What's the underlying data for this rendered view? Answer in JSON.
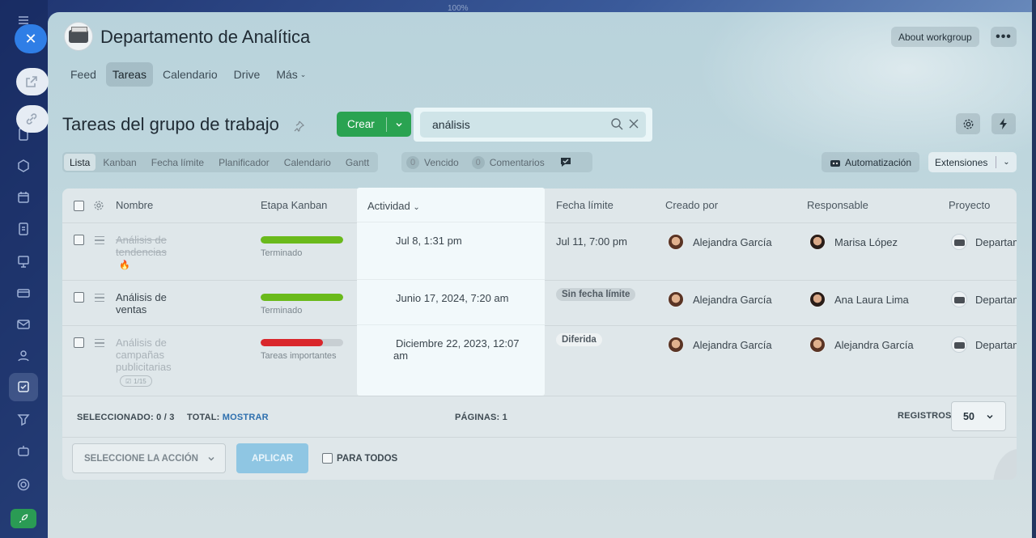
{
  "zoom": "100%",
  "group": {
    "title": "Departamento de Analítica",
    "about_label": "About workgroup"
  },
  "tabs": [
    {
      "label": "Feed",
      "active": false
    },
    {
      "label": "Tareas",
      "active": true
    },
    {
      "label": "Calendario",
      "active": false
    },
    {
      "label": "Drive",
      "active": false
    },
    {
      "label": "Más",
      "active": false
    }
  ],
  "page_title": "Tareas del grupo de trabajo",
  "toolbar": {
    "create_label": "Crear",
    "search_value": "análisis"
  },
  "views": [
    "Lista",
    "Kanban",
    "Fecha límite",
    "Planificador",
    "Calendario",
    "Gantt"
  ],
  "filters": {
    "overdue_count": "0",
    "overdue_label": "Vencido",
    "comments_count": "0",
    "comments_label": "Comentarios"
  },
  "automation_label": "Automatización",
  "extensions_label": "Extensiones",
  "columns": {
    "name": "Nombre",
    "stage": "Etapa Kanban",
    "activity": "Actividad",
    "deadline": "Fecha límite",
    "created_by": "Creado por",
    "responsible": "Responsable",
    "project": "Proyecto"
  },
  "rows": [
    {
      "name_line1": "Análisis de",
      "name_line2": "tendencias",
      "name_line3": "",
      "completed": true,
      "stage": "Terminado",
      "progress": 1.0,
      "bar_color": "#6aba1b",
      "activity": "Jul 8, 1:31 pm",
      "activity_line2": "",
      "deadline": "Jul 11, 7:00 pm",
      "created_by": "Alejandra García",
      "responsible": "Marisa López",
      "project": "Departamento de Analítica"
    },
    {
      "name_line1": "Análisis de",
      "name_line2": "ventas",
      "name_line3": "",
      "completed": false,
      "stage": "Terminado",
      "progress": 1.0,
      "bar_color": "#6aba1b",
      "activity": "Junio 17, 2024, 7:20 am",
      "activity_line2": "",
      "deadline": "Sin fecha límite",
      "created_by": "Alejandra García",
      "responsible": "Ana Laura Lima",
      "project": "Departamento de Analítica"
    },
    {
      "name_line1": "Análisis de",
      "name_line2": "campañas",
      "name_line3": "publicitarias",
      "completed": false,
      "stage": "Tareas importantes",
      "progress": 0.75,
      "bar_color": "#d9262b",
      "checklist": "1/15",
      "activity": "Diciembre 22, 2023, 12:07",
      "activity_line2": "am",
      "deadline": "Diferida",
      "created_by": "Alejandra García",
      "responsible": "Alejandra García",
      "project": "Departamento de Analítica"
    }
  ],
  "footer": {
    "selected_label": "SELECCIONADO:",
    "selected_value": "0 / 3",
    "total_label": "TOTAL:",
    "total_link": "MOSTRAR",
    "pages_label": "PÁGINAS:",
    "pages_value": "1",
    "records_label": "REGISTROS:",
    "records_value": "50"
  },
  "actions": {
    "select_placeholder": "SELECCIONE LA ACCIÓN",
    "apply_label": "APLICAR",
    "for_all_label": "PARA TODOS"
  }
}
